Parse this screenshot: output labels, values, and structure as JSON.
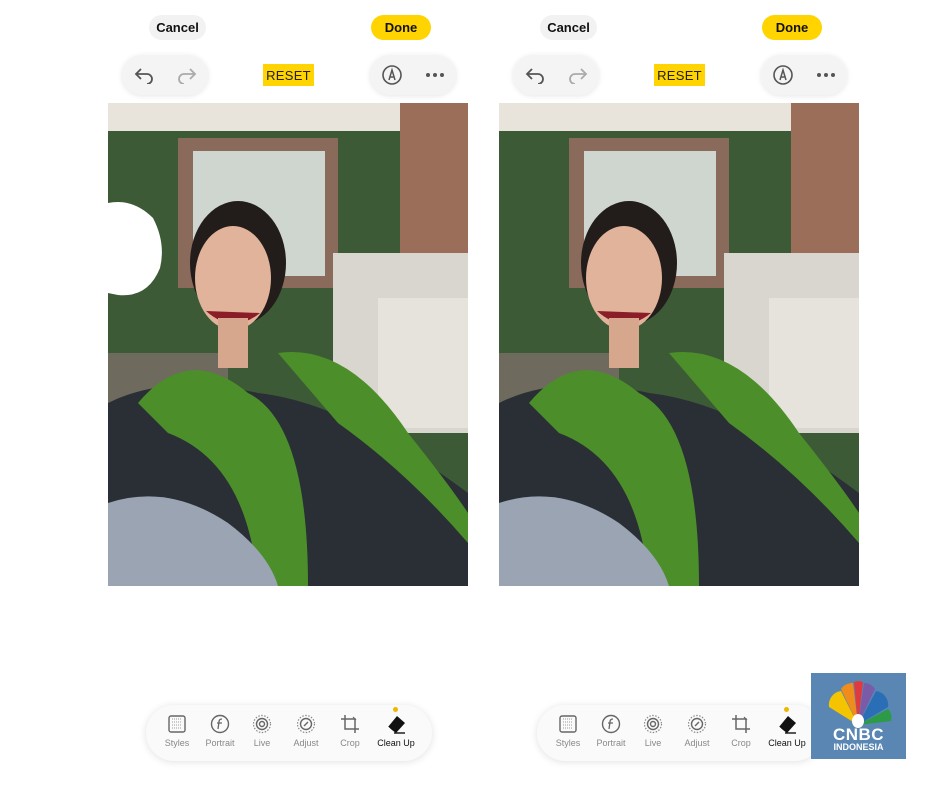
{
  "panels": [
    {
      "cancel_label": "Cancel",
      "done_label": "Done",
      "reset_label": "RESET",
      "photo_state": "with-artifact",
      "tools": [
        {
          "label": "Styles",
          "icon": "styles-icon"
        },
        {
          "label": "Portrait",
          "icon": "portrait-f-icon"
        },
        {
          "label": "Live",
          "icon": "live-icon"
        },
        {
          "label": "Adjust",
          "icon": "adjust-dial-icon"
        },
        {
          "label": "Crop",
          "icon": "crop-icon"
        },
        {
          "label": "Clean Up",
          "icon": "eraser-icon",
          "active": true
        }
      ]
    },
    {
      "cancel_label": "Cancel",
      "done_label": "Done",
      "reset_label": "RESET",
      "photo_state": "cleaned",
      "tools": [
        {
          "label": "Styles",
          "icon": "styles-icon"
        },
        {
          "label": "Portrait",
          "icon": "portrait-f-icon"
        },
        {
          "label": "Live",
          "icon": "live-icon"
        },
        {
          "label": "Adjust",
          "icon": "adjust-dial-icon"
        },
        {
          "label": "Crop",
          "icon": "crop-icon"
        },
        {
          "label": "Clean Up",
          "icon": "eraser-icon",
          "active": true
        }
      ]
    }
  ],
  "logo": {
    "line1": "CNBC",
    "line2": "INDONESIA"
  },
  "colors": {
    "accent": "#ffd400",
    "active_dot": "#f2b600",
    "logo_bg": "#5a86b3"
  }
}
